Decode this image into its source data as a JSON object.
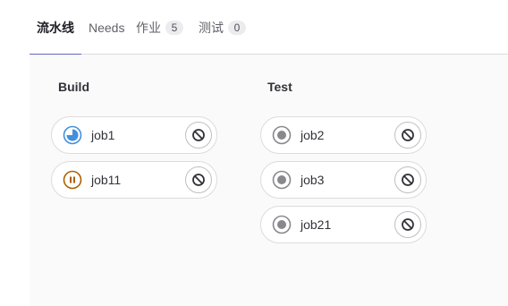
{
  "tabs": {
    "pipeline": {
      "label": "流水线"
    },
    "needs": {
      "label": "Needs"
    },
    "jobs": {
      "label": "作业",
      "count": "5"
    },
    "tests": {
      "label": "测试",
      "count": "0"
    }
  },
  "stages": {
    "build": {
      "title": "Build",
      "jobs": [
        {
          "name": "job1",
          "status": "running",
          "status_icon": "status-running-icon",
          "action_icon": "cancel-icon"
        },
        {
          "name": "job11",
          "status": "paused",
          "status_icon": "status-paused-icon",
          "action_icon": "cancel-icon"
        }
      ]
    },
    "test": {
      "title": "Test",
      "jobs": [
        {
          "name": "job2",
          "status": "created",
          "status_icon": "status-created-icon",
          "action_icon": "cancel-icon"
        },
        {
          "name": "job3",
          "status": "created",
          "status_icon": "status-created-icon",
          "action_icon": "cancel-icon"
        },
        {
          "name": "job21",
          "status": "created",
          "status_icon": "status-created-icon",
          "action_icon": "cancel-icon"
        }
      ]
    }
  },
  "colors": {
    "accent": "#6666c4",
    "running": "#428fdc",
    "paused": "#ab6100",
    "created": "#89888d"
  }
}
